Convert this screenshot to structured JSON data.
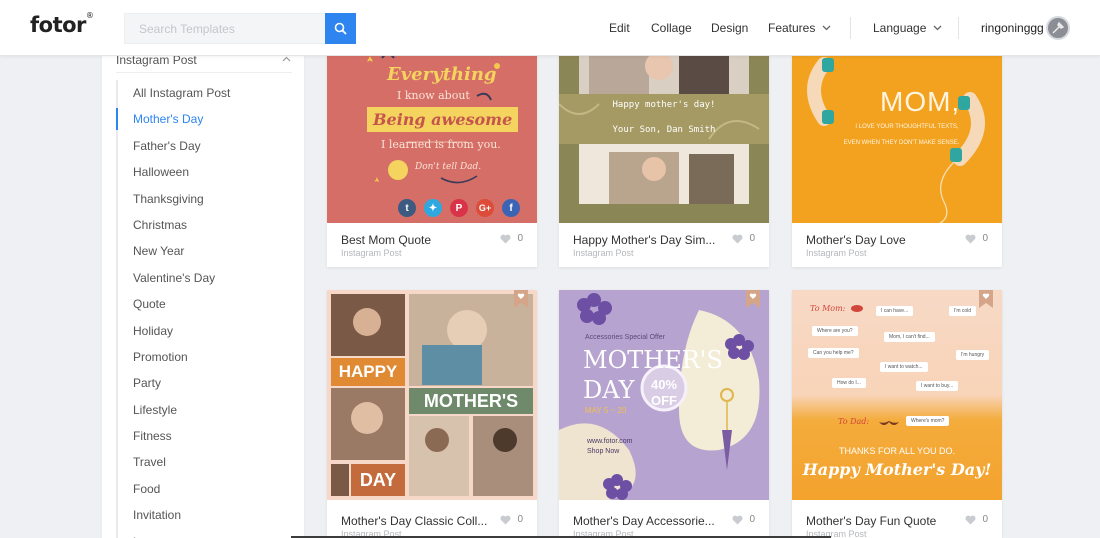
{
  "header": {
    "logo": "fotor",
    "logo_mark": "®",
    "search_placeholder": "Search Templates",
    "nav": [
      "Edit",
      "Collage",
      "Design",
      "Features",
      "Language"
    ],
    "username": "ringoninggg"
  },
  "sidebar": {
    "heading": "Instagram Post",
    "items": [
      "All Instagram Post",
      "Mother's Day",
      "Father's Day",
      "Halloween",
      "Thanksgiving",
      "Christmas",
      "New Year",
      "Valentine's Day",
      "Quote",
      "Holiday",
      "Promotion",
      "Party",
      "Lifestyle",
      "Fitness",
      "Travel",
      "Food",
      "Invitation",
      "Love"
    ],
    "active_index": 1
  },
  "cards": [
    {
      "title": "Best Mom Quote",
      "type": "Instagram Post",
      "likes": "0",
      "art": {
        "line1": "Everything",
        "line2": "I know about",
        "line3": "Being awesome",
        "line4": "I learned is from you.",
        "line5": "Don't tell Dad."
      }
    },
    {
      "title": "Happy Mother's Day Sim...",
      "type": "Instagram Post",
      "likes": "0",
      "art": {
        "line1": "Happy mother's day!",
        "line2": "Your Son, Dan Smith"
      }
    },
    {
      "title": "Mother's Day Love",
      "type": "Instagram Post",
      "likes": "0",
      "art": {
        "line1": "MOM,",
        "line2": "I LOVE YOUR THOUGHTFUL TEXTS,",
        "line3": "EVEN WHEN THEY DON'T MAKE SENSE."
      }
    },
    {
      "title": "Mother's Day Classic Coll...",
      "type": "Instagram Post",
      "likes": "0",
      "art": {
        "line1": "HAPPY",
        "line2": "MOTHER'S",
        "line3": "DAY"
      }
    },
    {
      "title": "Mother's Day Accessorie...",
      "type": "Instagram Post",
      "likes": "0",
      "art": {
        "line1": "Accessories Special Offer",
        "line2": "MOTHER'S",
        "line3": "DAY",
        "line4": "40%",
        "line5": "OFF",
        "line6": "MAY 5 ~ 20",
        "line7": "www.fotor.com",
        "line8": "Shop Now"
      }
    },
    {
      "title": "Mother's Day Fun Quote",
      "type": "Instagram Post",
      "likes": "0",
      "art": {
        "mom": "To Mom:",
        "bubbles": [
          "I can't find...",
          "I can have...",
          "Where are you?",
          "Mom, I can't find...",
          "Can you help me?",
          "I'm hungry",
          "I want to watch...",
          "How do I...",
          "I want to buy...",
          "I'm cold"
        ],
        "dad": "To Dad:",
        "dad_bubble": "Where's mom?",
        "thanks": "THANKS FOR ALL YOU DO.",
        "greeting": "Happy Mother's Day!"
      }
    }
  ]
}
